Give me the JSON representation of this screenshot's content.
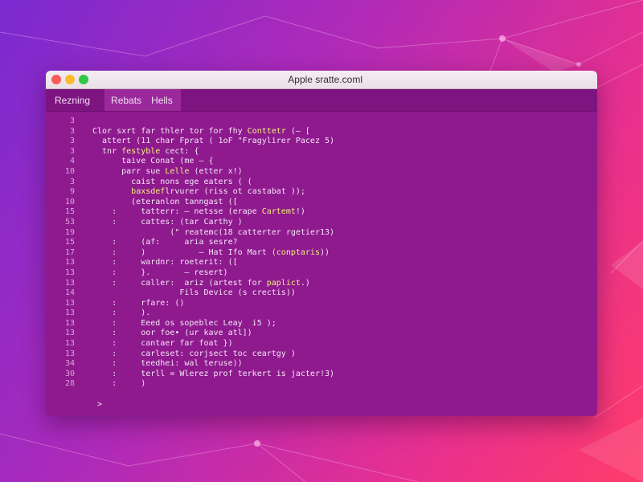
{
  "window": {
    "title": "Apple sratte.coml"
  },
  "tabs": [
    {
      "label": "Rezning"
    },
    {
      "label": "Rebats"
    },
    {
      "label": "Hells"
    }
  ],
  "colors": {
    "background_start": "#7a2ad0",
    "background_end": "#ff3c6a",
    "window_body": "#8e1a8e",
    "highlight": "#f2f07a",
    "close": "#fc5b57",
    "minimize": "#fdbc2e",
    "maximize": "#33c748"
  },
  "editor": {
    "line_numbers": [
      "3",
      "3",
      "3",
      "3",
      "4",
      "10",
      "3",
      "9",
      "10",
      "15",
      "53",
      "19",
      "15",
      "17",
      "13",
      "13",
      "13",
      "14",
      "13",
      "13",
      "13",
      "13",
      "13",
      "13",
      "34",
      "30",
      "28"
    ],
    "lines": [
      {
        "pre": "",
        "hl": "",
        "post": ""
      },
      {
        "pre": "Clor sxrt far thler tor for fhy ",
        "hl": "Conttetr",
        "post": " (— ["
      },
      {
        "pre": "  attert (11 char Fprat ( 1oF \"Fragylirer Pacez 5)",
        "hl": "",
        "post": ""
      },
      {
        "pre": "  tnr ",
        "hl": "festyble",
        "post": " cect: {"
      },
      {
        "pre": "      taive Conat (me — {",
        "hl": "",
        "post": ""
      },
      {
        "pre": "      parr sue ",
        "hl": "Lelle",
        "post": " (etter x!)"
      },
      {
        "pre": "        caist nons ege eaters ( (",
        "hl": "",
        "post": ""
      },
      {
        "pre": "        ",
        "hl": "baxsdef",
        "post": "lrvurer (riss ot castabat ));"
      },
      {
        "pre": "        (eteranlon tanngast ([",
        "hl": "",
        "post": ""
      },
      {
        "pre": "    :     tatterr: — netsse (erape ",
        "hl": "Cartemt",
        "post": "!)"
      },
      {
        "pre": "    :     cattes: (tar Carthy )",
        "hl": "",
        "post": ""
      },
      {
        "pre": "                (\" reatemc(18 catterter rgetier13)",
        "hl": "",
        "post": ""
      },
      {
        "pre": "    :     (af:     aria sesre?",
        "hl": "",
        "post": ""
      },
      {
        "pre": "    :     )           — Hat Ifo Mart ",
        "hl": "(conptaris",
        "post": "))"
      },
      {
        "pre": "    :     wardnr: roeterit: ([",
        "hl": "",
        "post": ""
      },
      {
        "pre": "    :     }.       — resert)",
        "hl": "",
        "post": ""
      },
      {
        "pre": "    :     caller:  ariz (artest for ",
        "hl": "paplict",
        "post": ".)"
      },
      {
        "pre": "                  Fils Device (s crectis))",
        "hl": "",
        "post": ""
      },
      {
        "pre": "    :     rfare: ()",
        "hl": "",
        "post": ""
      },
      {
        "pre": "    :     ).",
        "hl": "",
        "post": ""
      },
      {
        "pre": "    :     Eeed os sopeblec Leay  i5 );",
        "hl": "",
        "post": ""
      },
      {
        "pre": "    :     oor foe• (ur kave atl])",
        "hl": "",
        "post": ""
      },
      {
        "pre": "    :     cantaer far foat })",
        "hl": "",
        "post": ""
      },
      {
        "pre": "    :     carleset: corjsect toc ceartgy )",
        "hl": "",
        "post": ""
      },
      {
        "pre": "    :     teedhei: wal teruse))",
        "hl": "",
        "post": ""
      },
      {
        "pre": "    :     terll = Wlerez prof terkert is jacter!3)",
        "hl": "",
        "post": ""
      },
      {
        "pre": "    :     )",
        "hl": "",
        "post": ""
      },
      {
        "pre": "",
        "hl": "",
        "post": ""
      },
      {
        "pre": " >",
        "hl": "",
        "post": ""
      }
    ]
  }
}
